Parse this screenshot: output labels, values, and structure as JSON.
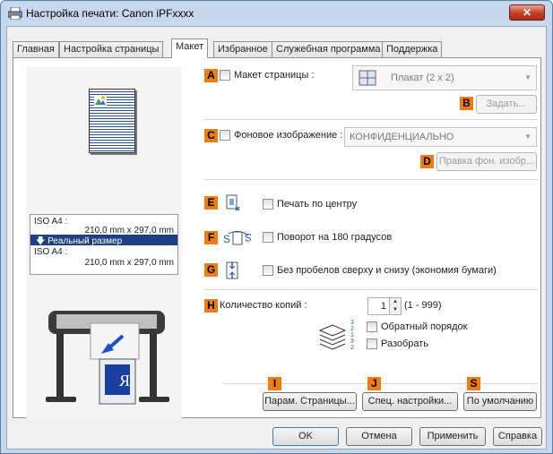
{
  "window": {
    "title": "Настройка печати: Canon iPFxxxx",
    "close_glyph": "✕"
  },
  "tabs": [
    {
      "label": "Главная"
    },
    {
      "label": "Настройка страницы"
    },
    {
      "label": "Макет"
    },
    {
      "label": "Избранное"
    },
    {
      "label": "Служебная программа"
    },
    {
      "label": "Поддержка"
    }
  ],
  "active_tab": "Макет",
  "preview": {
    "iso_top": "ISO A4 :",
    "size_top": "210,0 mm x 297,0 mm",
    "real_size": "Реальный размер",
    "iso_bottom": "ISO A4 :",
    "size_bottom": "210,0 mm x 297,0 mm",
    "arrow_glyph": "🡇"
  },
  "markers": {
    "A": "A",
    "B": "B",
    "C": "C",
    "D": "D",
    "E": "E",
    "F": "F",
    "G": "G",
    "H": "H",
    "I": "I",
    "J": "J",
    "S": "S"
  },
  "layout": {
    "page_layout_label": "Макет страницы :",
    "page_layout_value": "Плакат (2 x 2)",
    "set_button": "Задать...",
    "bg_image_label": "Фоновое изображение :",
    "bg_image_value": "КОНФИДЕНЦИАЛЬНО",
    "edit_bg_button": "Правка фон. изобр...",
    "center_label": "Печать по центру",
    "rotate_label": "Поворот на 180 градусов",
    "no_margin_label": "Без пробелов сверху и снизу (экономия бумаги)",
    "copies_label": "Количество копий :",
    "copies_value": "1",
    "copies_range": "(1 - 999)",
    "reverse_label": "Обратный порядок",
    "collate_label": "Разобрать"
  },
  "bottom_buttons": {
    "page_options": "Парам. Страницы...",
    "special_settings": "Спец. настройки...",
    "defaults": "По умолчанию"
  },
  "dialog_buttons": {
    "ok": "OK",
    "cancel": "Отмена",
    "apply": "Применить",
    "help": "Справка"
  }
}
